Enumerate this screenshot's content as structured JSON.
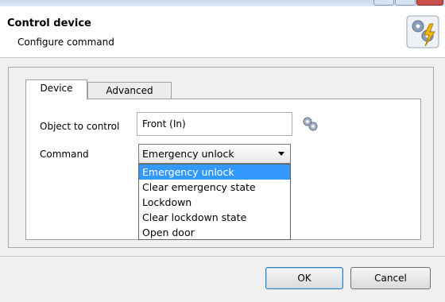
{
  "dialog": {
    "title": "Control device",
    "subtitle": "Configure command",
    "icon": "gear-lightning-icon"
  },
  "tabs": [
    {
      "label": "Device",
      "active": true
    },
    {
      "label": "Advanced",
      "active": false
    }
  ],
  "form": {
    "object_label": "Object to control",
    "object_value": "Front (In)",
    "object_button_icon": "gear-icon",
    "command_label": "Command",
    "command_value": "Emergency unlock",
    "command_options": [
      "Emergency unlock",
      "Clear emergency state",
      "Lockdown",
      "Clear lockdown state",
      "Open door"
    ],
    "highlighted_option": "Emergency unlock"
  },
  "buttons": {
    "ok": "OK",
    "cancel": "Cancel"
  },
  "colors": {
    "selection": "#3399ff",
    "default_button_border": "#3c7fb1"
  }
}
